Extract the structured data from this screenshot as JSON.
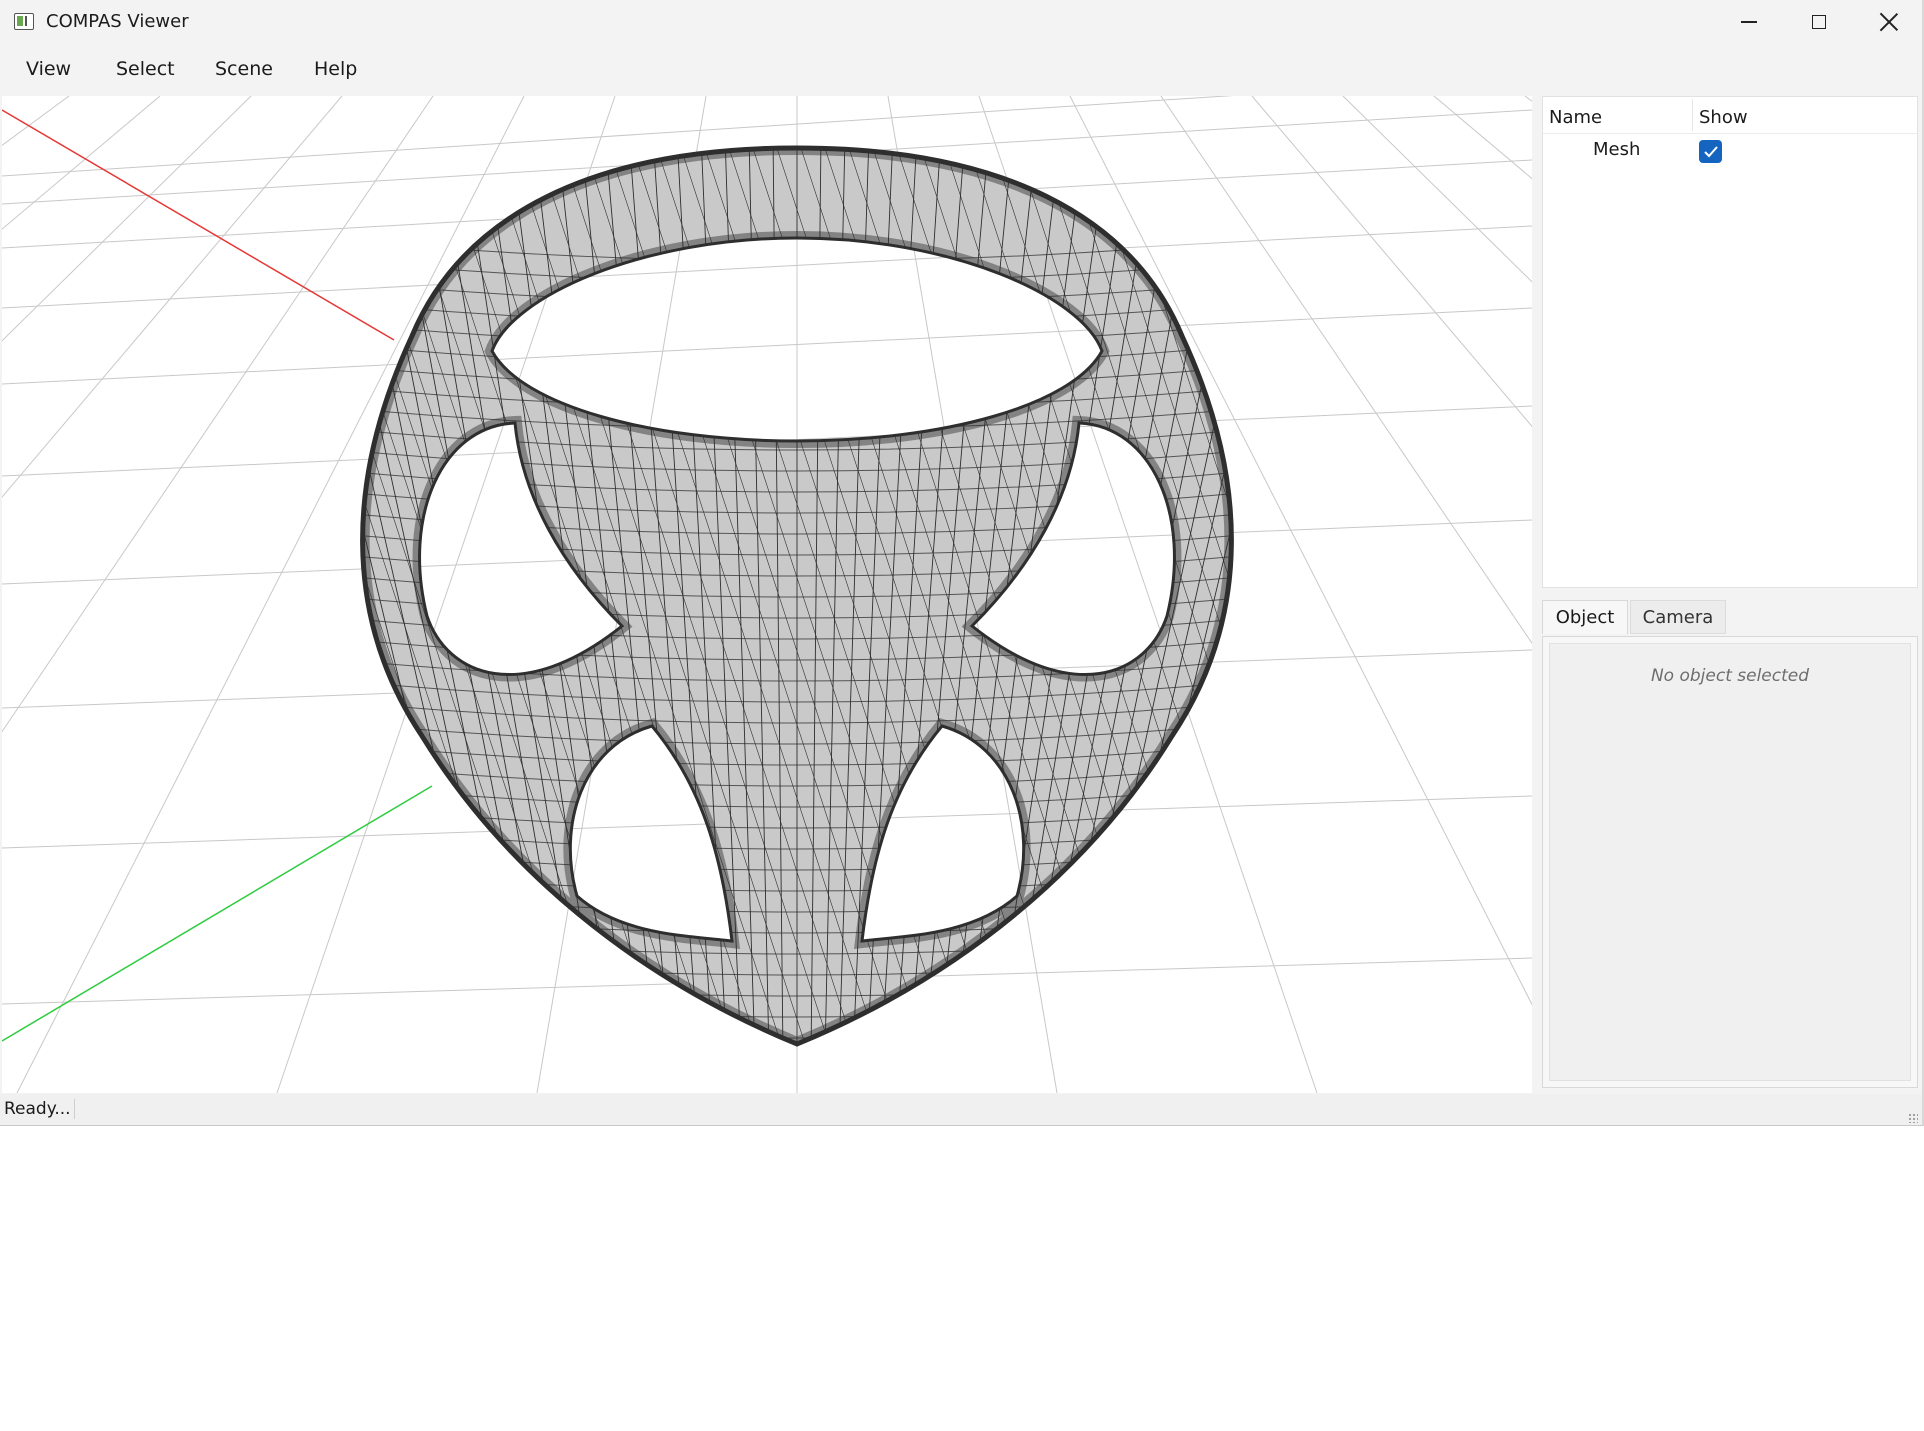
{
  "window": {
    "title": "COMPAS Viewer"
  },
  "menu": {
    "items": [
      "View",
      "Select",
      "Scene",
      "Help"
    ]
  },
  "scene_tree": {
    "columns": [
      "Name",
      "Show"
    ],
    "rows": [
      {
        "name": "Mesh",
        "show": true
      }
    ]
  },
  "tabs": [
    "Object",
    "Camera"
  ],
  "object_panel": {
    "empty_message": "No object selected"
  },
  "status": {
    "text": "Ready..."
  },
  "viewport": {
    "x_axis_color": "#e53935",
    "y_axis_color": "#2ecc40",
    "grid_color": "#c8c8c8",
    "mesh_edge_color": "#2e2e2e",
    "mesh_face_color": "#c9c9c9"
  },
  "colors": {
    "accent": "#1565c0"
  },
  "icons": {
    "app": "compas-app-icon",
    "minimize": "minimize-icon",
    "maximize": "maximize-icon",
    "close": "close-icon",
    "checkbox": "checkmark-icon"
  }
}
